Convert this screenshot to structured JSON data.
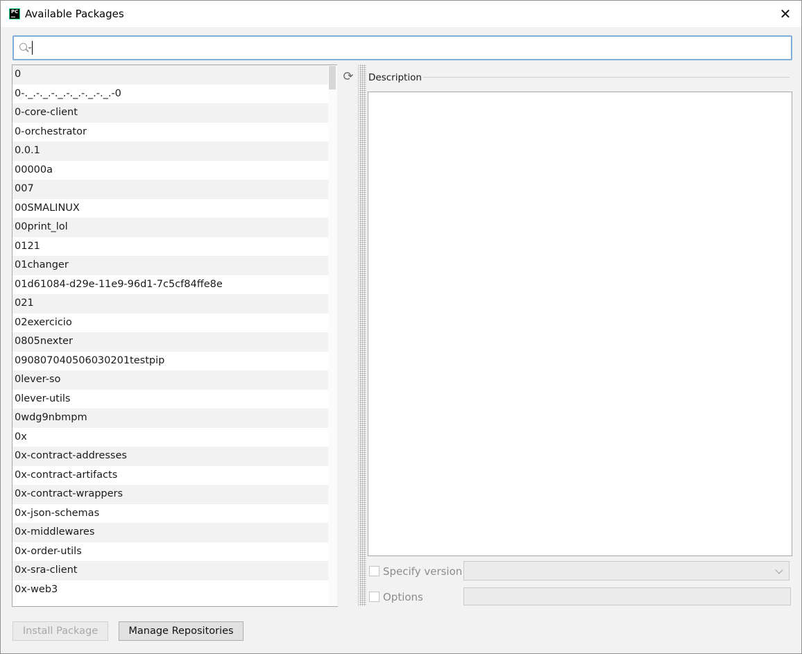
{
  "window": {
    "title": "Available Packages",
    "app_icon_text": "PC",
    "close_glyph": "✕"
  },
  "search": {
    "value": "",
    "placeholder": ""
  },
  "packages": [
    "0",
    "0-._.-._.-._.-._.-._.-._.-0",
    "0-core-client",
    "0-orchestrator",
    "0.0.1",
    "00000a",
    "007",
    "00SMALINUX",
    "00print_lol",
    "0121",
    "01changer",
    "01d61084-d29e-11e9-96d1-7c5cf84ffe8e",
    "021",
    "02exercicio",
    "0805nexter",
    "090807040506030201testpip",
    "0lever-so",
    "0lever-utils",
    "0wdg9nbmpm",
    "0x",
    "0x-contract-addresses",
    "0x-contract-artifacts",
    "0x-contract-wrappers",
    "0x-json-schemas",
    "0x-middlewares",
    "0x-order-utils",
    "0x-sra-client",
    "0x-web3"
  ],
  "refresh_glyph": "⟳",
  "description": {
    "label": "Description",
    "text": ""
  },
  "specify_version": {
    "label": "Specify version",
    "checked": false,
    "selected": ""
  },
  "options": {
    "label": "Options",
    "checked": false,
    "value": ""
  },
  "buttons": {
    "install": "Install Package",
    "manage": "Manage Repositories"
  }
}
